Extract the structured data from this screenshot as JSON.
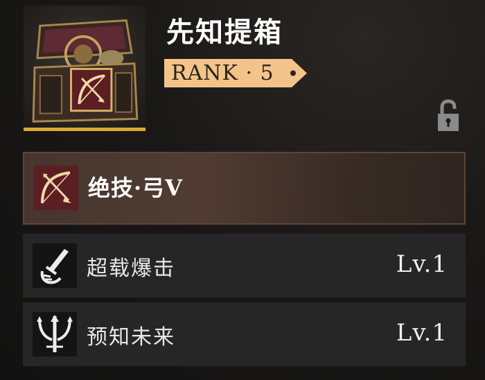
{
  "item": {
    "name": "先知提箱",
    "rank_label": "RANK · 5",
    "icon": "treasure-chest-icon",
    "rarity_color": "#d8ac32",
    "locked": false,
    "lock_icon": "unlocked-padlock-icon"
  },
  "skills": [
    {
      "name": "绝技·弓V",
      "icon": "bow-arrow-icon",
      "level": ""
    },
    {
      "name": "超载爆击",
      "icon": "sword-hand-icon",
      "level": "Lv.1"
    },
    {
      "name": "预知未来",
      "icon": "trident-icon",
      "level": "Lv.1"
    }
  ],
  "colors": {
    "rank_tag": "#f3c48a",
    "main_skill_icon_bg": "#5b1e22",
    "row_bg": "#262626"
  }
}
